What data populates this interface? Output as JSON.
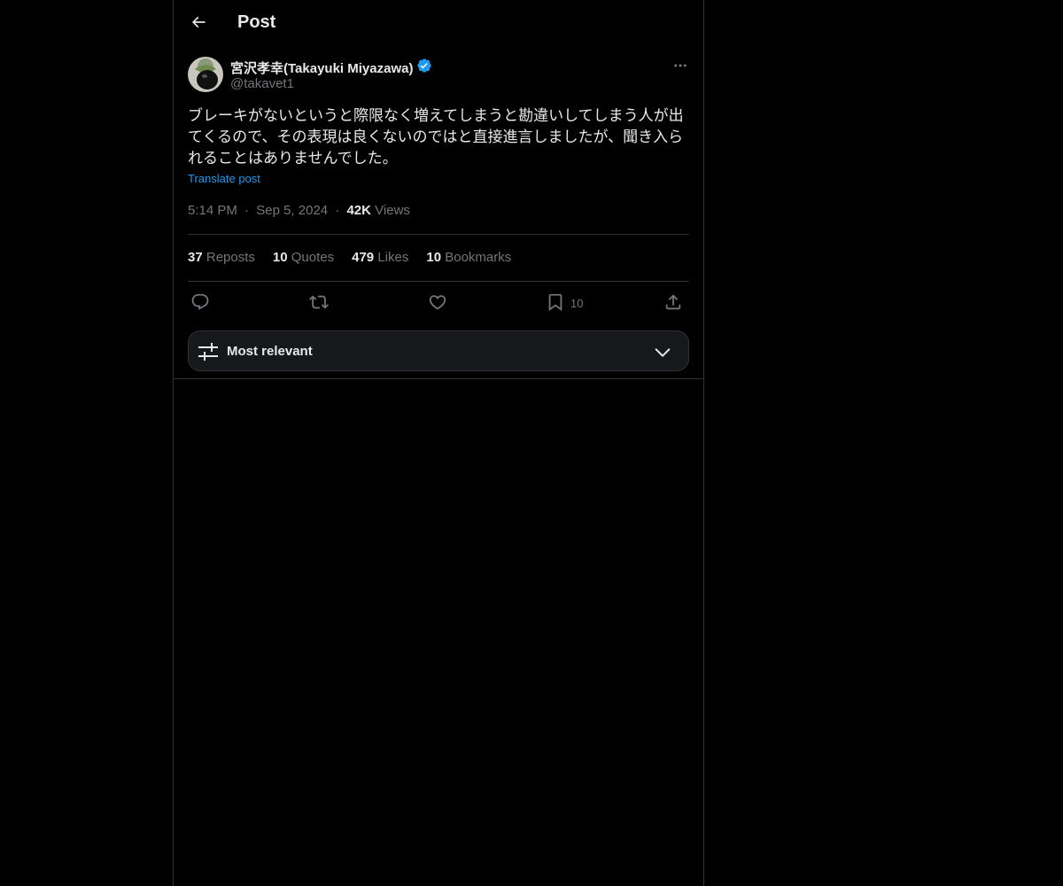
{
  "header": {
    "title": "Post"
  },
  "post": {
    "author_name": "宮沢孝幸(Takayuki Miyazawa)",
    "author_handle": "@takavet1",
    "text": "ブレーキがないというと際限なく増えてしまうと勘違いしてしまう人が出てくるので、その表現は良くないのではと直接進言しましたが、聞き入られることはありませんでした。",
    "translate_label": "Translate post",
    "time": "5:14 PM",
    "date": "Sep 5, 2024",
    "separator": "·",
    "views_count": "42K",
    "views_label": "Views"
  },
  "stats": {
    "reposts_count": "37",
    "reposts_label": "Reposts",
    "quotes_count": "10",
    "quotes_label": "Quotes",
    "likes_count": "479",
    "likes_label": "Likes",
    "bookmarks_count": "10",
    "bookmarks_label": "Bookmarks"
  },
  "actions": {
    "reply_icon": "reply-icon",
    "repost_icon": "repost-icon",
    "like_icon": "heart-icon",
    "bookmark_icon": "bookmark-icon",
    "bookmark_count": "10",
    "share_icon": "share-icon"
  },
  "sort": {
    "label": "Most relevant"
  },
  "colors": {
    "background": "#000000",
    "text_primary": "#e7e9ea",
    "text_secondary": "#71767b",
    "accent": "#1d9bf0",
    "border": "#2f3336",
    "sort_bg": "#16181c"
  }
}
